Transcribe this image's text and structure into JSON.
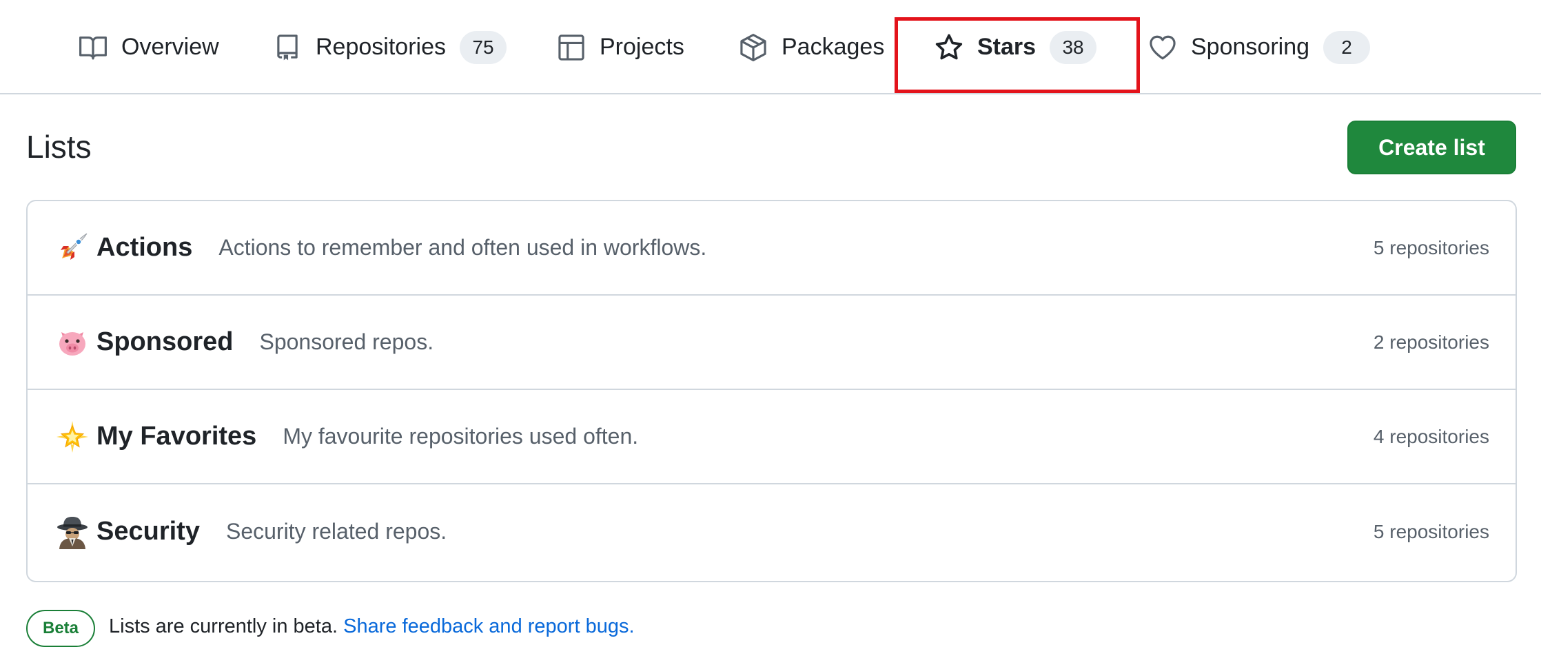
{
  "tabs": [
    {
      "label": "Overview",
      "icon": "book-icon"
    },
    {
      "label": "Repositories",
      "icon": "repo-icon",
      "count": "75"
    },
    {
      "label": "Projects",
      "icon": "table-icon"
    },
    {
      "label": "Packages",
      "icon": "package-icon"
    },
    {
      "label": "Stars",
      "icon": "star-icon",
      "count": "38",
      "selected": true
    },
    {
      "label": "Sponsoring",
      "icon": "heart-icon",
      "count": "2"
    }
  ],
  "header": {
    "title": "Lists",
    "create_button_label": "Create list"
  },
  "lists": [
    {
      "emoji": "rocket-emoji",
      "name": "Actions",
      "description": "Actions to remember and often used in workflows.",
      "count": "5 repositories"
    },
    {
      "emoji": "pig-face-emoji",
      "name": "Sponsored",
      "description": "Sponsored repos.",
      "count": "2 repositories"
    },
    {
      "emoji": "glowing-star-emoji",
      "name": "My Favorites",
      "description": "My favourite repositories used often.",
      "count": "4 repositories"
    },
    {
      "emoji": "spy-emoji",
      "name": "Security",
      "description": "Security related repos.",
      "count": "5 repositories"
    }
  ],
  "footer": {
    "badge": "Beta",
    "text": "Lists are currently in beta.",
    "link": "Share feedback and report bugs."
  },
  "colors": {
    "primary_button": "#1f883d",
    "link": "#0969da",
    "highlight": "#e3131b",
    "border": "#d0d7de"
  }
}
